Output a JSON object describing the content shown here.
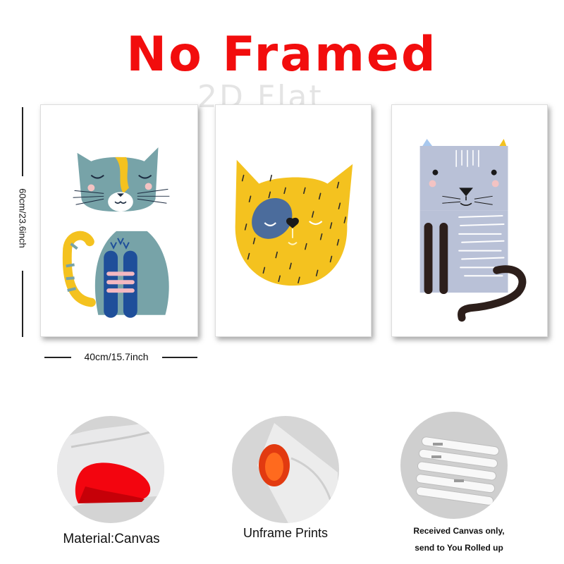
{
  "title": "No Framed",
  "watermark": "2D Flat",
  "dimensions": {
    "height_label": "60cm/23.6inch",
    "width_label": "40cm/15.7inch"
  },
  "prints": [
    {
      "subject": "blue cat sitting"
    },
    {
      "subject": "yellow cat face"
    },
    {
      "subject": "grey striped cat"
    }
  ],
  "features": [
    {
      "caption": "Material:Canvas"
    },
    {
      "caption": "Unframe  Prints"
    },
    {
      "caption_line1": "Received Canvas only,",
      "caption_line2": "send to You Rolled up"
    }
  ],
  "colors": {
    "title": "#f20d0d",
    "blue_cat": "#77a3a8",
    "yellow": "#f4c21f",
    "grey_cat": "#b9c1d7",
    "navy": "#1f4f9a"
  }
}
